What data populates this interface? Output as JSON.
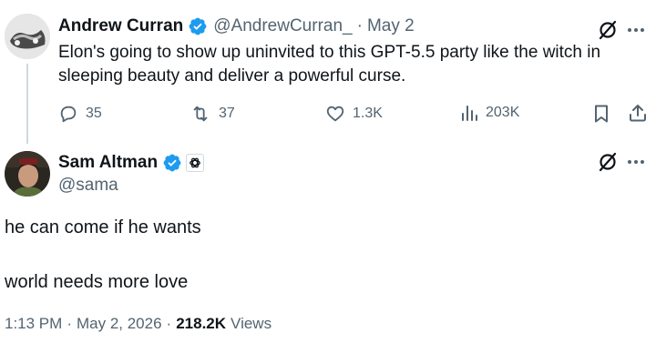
{
  "quoted_tweet": {
    "author_name": "Andrew Curran",
    "author_handle": "@AndrewCurran_",
    "separator": "·",
    "date": "May 2",
    "text_line1": "Elon's going to show up uninvited to this GPT-5.5 party like the witch in",
    "text_line2": "sleeping beauty and deliver a powerful curse.",
    "replies": "35",
    "reposts": "37",
    "likes": "1.3K",
    "views": "203K"
  },
  "main_tweet": {
    "author_name": "Sam Altman",
    "author_handle": "@sama",
    "paragraph1": "he can come if he wants",
    "paragraph2": "world needs more love",
    "time": "1:13 PM",
    "separator": "·",
    "date": "May 2, 2026",
    "separator2": "·",
    "view_count": "218.2K",
    "views_label": "Views"
  },
  "colors": {
    "verified_blue": "#1d9bf0",
    "text_primary": "#0f1419",
    "text_secondary": "#536471"
  },
  "icons": [
    "grok-icon",
    "more-icon",
    "reply-icon",
    "repost-icon",
    "like-icon",
    "views-icon",
    "bookmark-icon",
    "share-icon",
    "verified-badge-icon",
    "openai-affiliate-icon"
  ]
}
